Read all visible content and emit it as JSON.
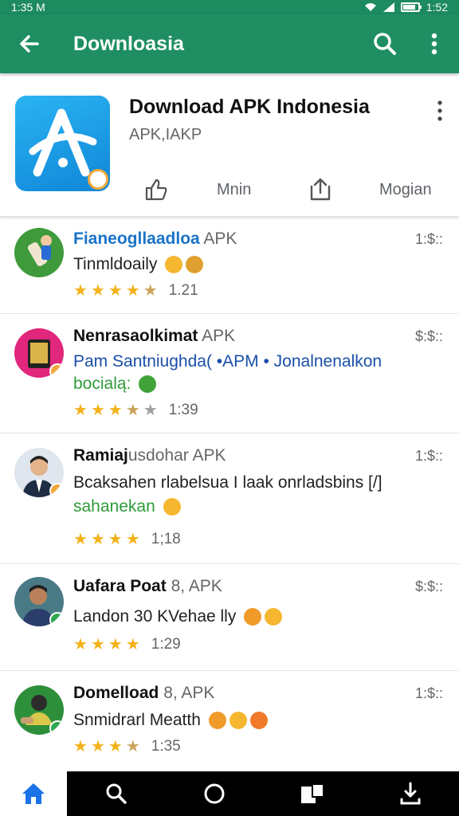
{
  "status_bar": {
    "time_left": "1:35 M",
    "time_right": "1:52",
    "battery_level": 0.85
  },
  "app_bar": {
    "title": "Downloasia",
    "icons": [
      "back-arrow-icon",
      "search-icon",
      "more-vert-icon"
    ]
  },
  "app_header": {
    "name": "Download APK Indonesia",
    "subtitle": "APK,IAKP",
    "actions": [
      {
        "icon": "thumbs-up-icon",
        "label": "Mnin"
      },
      {
        "icon": "share-icon",
        "label": "Mogian"
      }
    ]
  },
  "list": [
    {
      "title": "Fianeogllaadloa",
      "apk": "APK",
      "time": "1:$::",
      "desc": "Tinmldoaily",
      "desc2": "",
      "rating": "1.21",
      "stars": 4.5,
      "avatar_color": "#3f9a3c",
      "badge_color": "",
      "title_color": "#1a73c8"
    },
    {
      "title": "Nenrasaolkimat",
      "apk": "APK",
      "time": "$:$::",
      "desc": "Pam Santniughda( •APM • Jonalnenalkon",
      "desc2": "bocialą:",
      "rating": "1:39",
      "stars": 3.5,
      "avatar_color": "#e0277b",
      "badge_color": "#f2a93b",
      "title_color": "#111111"
    },
    {
      "title": "Ramiaj",
      "apk": "usdohar APK",
      "time": "1:$::",
      "desc": "Bcaksahen rlabelsua I laak onrladsbins [/]",
      "desc2": "sahanekan",
      "rating": "1;18",
      "stars": 4,
      "avatar_color": "#dfe6ee",
      "badge_color": "#f2a93b",
      "title_color": "#111111"
    },
    {
      "title": "Uafara Poat",
      "apk": "8, APK",
      "time": "$:$::",
      "desc": "Landon 30 KVehae lly",
      "desc2": "",
      "rating": "1:29",
      "stars": 4,
      "avatar_color": "#4a7a86",
      "badge_color": "#2fa84f",
      "title_color": "#111111"
    },
    {
      "title": "Domelload",
      "apk": "8, APK",
      "time": "1:$::",
      "desc": "Snmidrarl Meatth",
      "desc2": "",
      "rating": "1:35",
      "stars": 3.5,
      "avatar_color": "#2e8f3a",
      "badge_color": "#2fa84f",
      "title_color": "#111111"
    }
  ],
  "bottom_nav": {
    "items": [
      "home-icon",
      "search-icon",
      "circle-icon",
      "library-icon",
      "download-icon"
    ],
    "active_index": 0
  },
  "colors": {
    "accent": "#1f8f63",
    "star": "#f3b21a",
    "link_blue": "#1a73c8",
    "green_text": "#2f9b3a"
  }
}
